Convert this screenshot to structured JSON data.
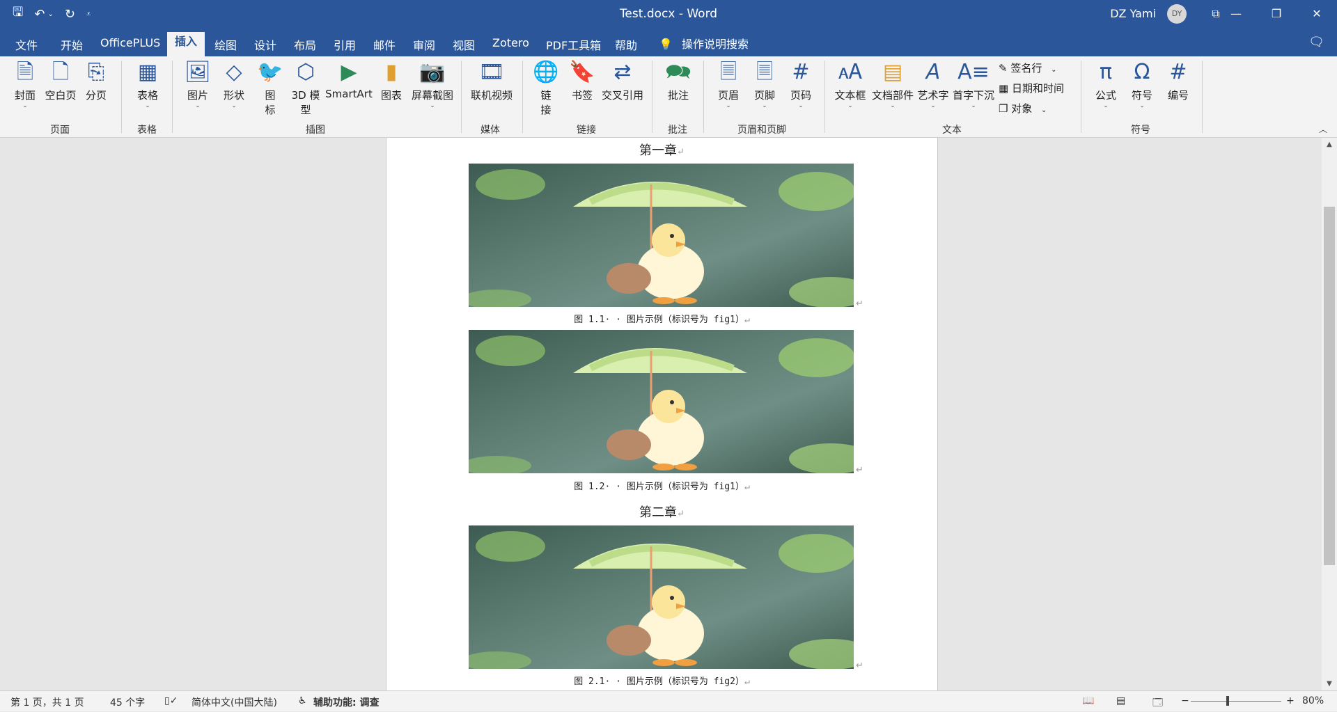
{
  "window": {
    "title": "Test.docx  -  Word",
    "user": "DZ Yami",
    "avatar_initials": "DY"
  },
  "quick_access": {
    "customize": "⩡"
  },
  "menu": {
    "tabs": [
      "文件",
      "开始",
      "OfficePLUS",
      "插入",
      "绘图",
      "设计",
      "布局",
      "引用",
      "邮件",
      "审阅",
      "视图",
      "Zotero",
      "PDF工具箱",
      "帮助"
    ],
    "active_tab": "插入",
    "search_label": "操作说明搜索"
  },
  "ribbon": {
    "groups": {
      "pages": "页面",
      "tables": "表格",
      "illustrations": "插图",
      "media": "媒体",
      "links": "链接",
      "comments": "批注",
      "header_footer": "页眉和页脚",
      "text": "文本",
      "symbols": "符号"
    },
    "buttons": {
      "cover": "封面",
      "blank_page": "空白页",
      "page_break": "分页",
      "table": "表格",
      "picture": "图片",
      "shapes": "形状",
      "icons_1": "图",
      "icons_2": "标",
      "model3d_1": "3D 模",
      "model3d_2": "型",
      "smartart": "SmartArt",
      "chart": "图表",
      "screenshot": "屏幕截图",
      "online_video": "联机视频",
      "link_1": "链",
      "link_2": "接",
      "bookmark": "书签",
      "cross_ref": "交叉引用",
      "comment": "批注",
      "header": "页眉",
      "footer": "页脚",
      "page_number": "页码",
      "text_box": "文本框",
      "doc_parts": "文档部件",
      "wordart": "艺术字",
      "drop_cap": "首字下沉",
      "signature_line": "签名行",
      "date_time": "日期和时间",
      "object": "对象",
      "equation": "公式",
      "symbol": "符号",
      "numbering": "编号"
    }
  },
  "document": {
    "paragraph_mark": "↵",
    "chapters": [
      {
        "heading": "第一章",
        "figures": [
          {
            "caption": "图 1.1· · 图片示例（标识号为 fig1）"
          },
          {
            "caption": "图 1.2· · 图片示例（标识号为 fig1）"
          }
        ]
      },
      {
        "heading": "第二章",
        "figures": [
          {
            "caption": "图 2.1· · 图片示例（标识号为 fig2）"
          }
        ]
      }
    ]
  },
  "status": {
    "page": "第 1 页，共 1 页",
    "words": "45 个字",
    "language": "简体中文(中国大陆)",
    "accessibility": "辅助功能: 调查",
    "zoom": "80%"
  },
  "colors": {
    "brand": "#2b579a",
    "ribbon_bg": "#f3f3f3",
    "workspace_bg": "#e6e6e6"
  }
}
